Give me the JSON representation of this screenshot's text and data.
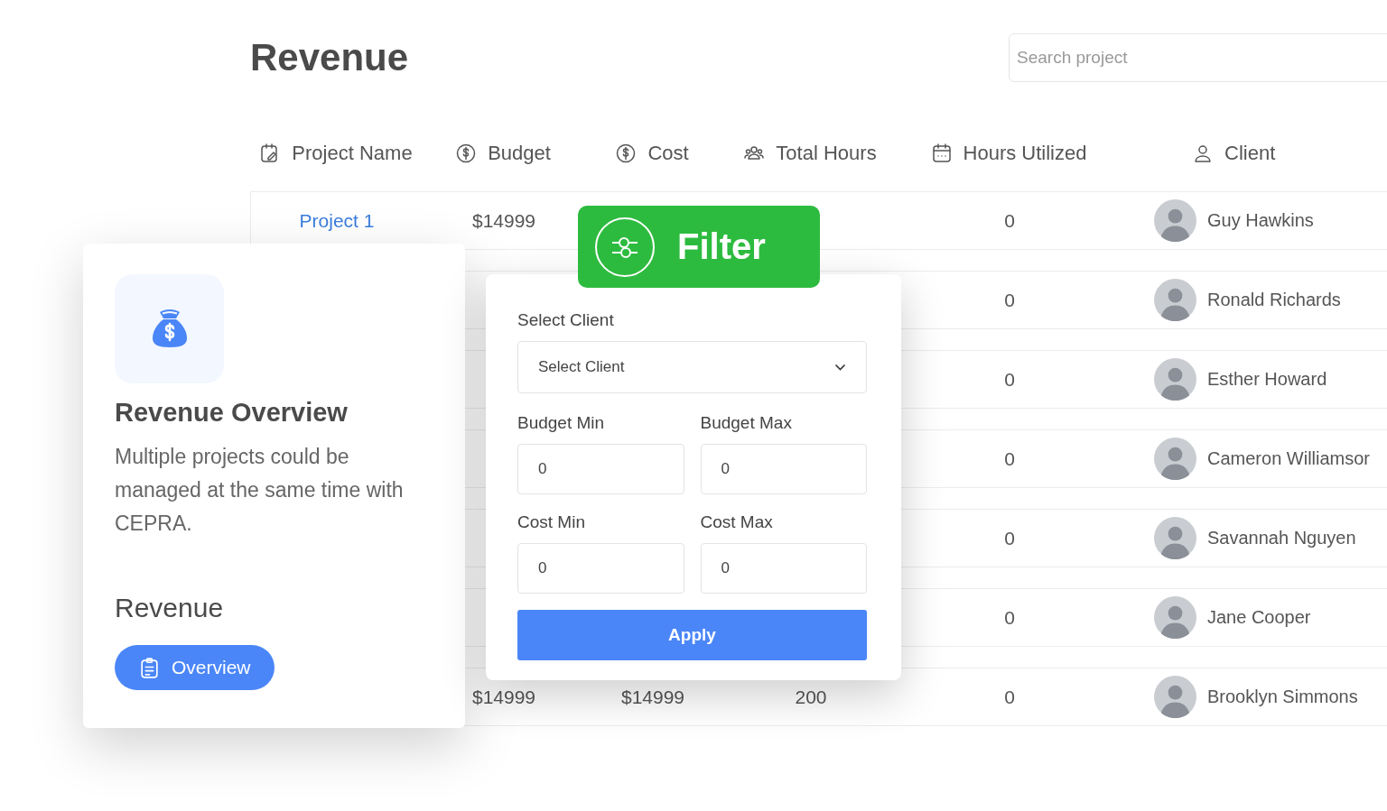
{
  "page": {
    "title": "Revenue"
  },
  "search": {
    "placeholder": "Search project"
  },
  "table": {
    "columns": [
      {
        "label": "Project Name",
        "kind": "project"
      },
      {
        "label": "Budget",
        "kind": "money"
      },
      {
        "label": "Cost",
        "kind": "money"
      },
      {
        "label": "Total Hours",
        "kind": "people"
      },
      {
        "label": "Hours Utilized",
        "kind": "calendar"
      },
      {
        "label": "Client",
        "kind": "person"
      }
    ],
    "rows": [
      {
        "project": "Project 1",
        "budget": "$14999",
        "hours_utilized": "0",
        "client": "Guy Hawkins"
      },
      {
        "hours_utilized": "0",
        "client": "Ronald Richards"
      },
      {
        "hours_utilized": "0",
        "client": "Esther Howard"
      },
      {
        "hours_utilized": "0",
        "client": "Cameron Williamsor"
      },
      {
        "hours_utilized": "0",
        "client": "Savannah Nguyen"
      },
      {
        "hours_utilized": "0",
        "client": "Jane Cooper"
      },
      {
        "budget": "$14999",
        "cost": "$14999",
        "total_hours": "200",
        "hours_utilized": "0",
        "client": "Brooklyn Simmons"
      }
    ]
  },
  "overview_card": {
    "title": "Revenue Overview",
    "text": "Multiple projects could be managed at the same time with CEPRA.",
    "subtitle": "Revenue",
    "button": "Overview"
  },
  "filter": {
    "badge": "Filter",
    "client_label": "Select Client",
    "client_select": {
      "placeholder": "Select Client"
    },
    "fields": [
      {
        "label": "Budget Min",
        "value": "0"
      },
      {
        "label": "Budget Max",
        "value": "0"
      },
      {
        "label": "Cost Min",
        "value": "0"
      },
      {
        "label": "Cost Max",
        "value": "0"
      }
    ],
    "apply": "Apply"
  }
}
